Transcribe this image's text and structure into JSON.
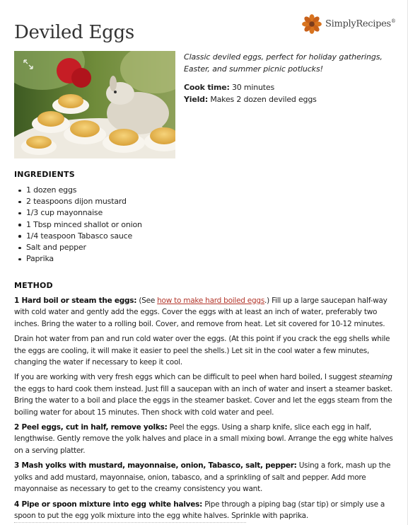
{
  "recipe": {
    "title": "Deviled Eggs",
    "description": "Classic deviled eggs, perfect for holiday gatherings, Easter, and summer picnic potlucks!",
    "cook_time_label": "Cook time:",
    "cook_time_value": "30 minutes",
    "yield_label": "Yield:",
    "yield_value": "Makes 2 dozen deviled eggs"
  },
  "brand": {
    "name": "SimplyRecipes",
    "registered": "®",
    "logo_icon": "flower-logo-icon",
    "logo_colors": [
      "#d8741f",
      "#7a3b1c"
    ]
  },
  "ingredients": {
    "heading": "INGREDIENTS",
    "items": [
      "1 dozen eggs",
      "2 teaspoons dijon mustard",
      "1/3 cup mayonnaise",
      "1 Tbsp minced shallot or onion",
      "1/4 teaspoon Tabasco sauce",
      "Salt and pepper",
      "Paprika"
    ]
  },
  "method": {
    "heading": "METHOD",
    "step1_title": "1 Hard boil or steam the eggs:",
    "step1_pre": " (See ",
    "step1_link": "how to make hard boiled eggs",
    "step1_post": ".) Fill up a large saucepan half-way with cold water and gently add the eggs. Cover the eggs with at least an inch of water, preferably two inches. Bring the water to a rolling boil. Cover, and remove from heat. Let sit covered for 10-12 minutes.",
    "step1_para2": "Drain hot water from pan and run cold water over the eggs. (At this point if you crack the egg shells while the eggs are cooling, it will make it easier to peel the shells.) Let sit in the cool water a few minutes, changing the water if necessary to keep it cool.",
    "step1_para3_pre": "If you are working with very fresh eggs which can be difficult to peel when hard boiled, I suggest ",
    "step1_para3_em": "steaming",
    "step1_para3_post": " the eggs to hard cook them instead. Just fill a saucepan with an inch of water and insert a steamer basket. Bring the water to a boil and place the eggs in the steamer basket. Cover and let the eggs steam from the boiling water for about 15 minutes. Then shock with cold water and peel.",
    "step2_title": "2 Peel eggs, cut in half, remove yolks:",
    "step2_text": " Peel the eggs. Using a sharp knife, slice each egg in half, lengthwise. Gently remove the yolk halves and place in a small mixing bowl. Arrange the egg white halves on a serving platter.",
    "step3_title": "3 Mash yolks with mustard, mayonnaise, onion, Tabasco, salt, pepper:",
    "step3_text": " Using a fork, mash up the yolks and add mustard, mayonnaise, onion, tabasco, and a sprinkling of salt and pepper. Add more mayonnaise as necessary to get to the creamy consistency you want.",
    "step4_title": "4 Pipe or spoon mixture into egg white halves:",
    "step4_text": " Pipe through a piping bag (star tip) or simply use a spoon to put the egg yolk mixture into the egg white halves. Sprinkle with paprika."
  },
  "hero_image": {
    "icon": "expand-icon"
  }
}
